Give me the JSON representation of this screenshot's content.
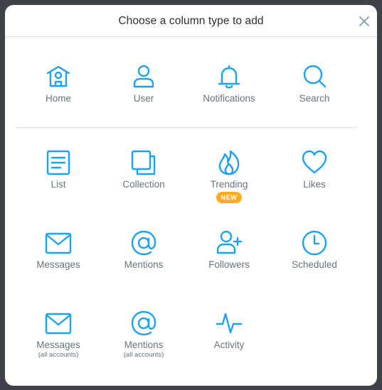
{
  "dialog": {
    "title": "Choose a column type to add",
    "close_icon": "close-icon"
  },
  "colors": {
    "accent": "#1da1f2",
    "label": "#66757f",
    "badge": "#ffad1f",
    "backdrop": "#3d4348"
  },
  "tiles": [
    {
      "label": "Home",
      "icon": "home-icon"
    },
    {
      "label": "User",
      "icon": "user-icon"
    },
    {
      "label": "Notifications",
      "icon": "bell-icon"
    },
    {
      "label": "Search",
      "icon": "search-icon"
    },
    {
      "label": "List",
      "icon": "list-icon"
    },
    {
      "label": "Collection",
      "icon": "collection-icon"
    },
    {
      "label": "Trending",
      "icon": "flame-icon",
      "badge": "NEW"
    },
    {
      "label": "Likes",
      "icon": "heart-icon"
    },
    {
      "label": "Messages",
      "icon": "envelope-icon"
    },
    {
      "label": "Mentions",
      "icon": "at-sign-icon"
    },
    {
      "label": "Followers",
      "icon": "add-user-icon"
    },
    {
      "label": "Scheduled",
      "icon": "clock-icon"
    },
    {
      "label": "Messages",
      "sub": "(all accounts)",
      "icon": "envelope-icon"
    },
    {
      "label": "Mentions",
      "sub": "(all accounts)",
      "icon": "at-sign-icon"
    },
    {
      "label": "Activity",
      "icon": "activity-icon"
    }
  ]
}
